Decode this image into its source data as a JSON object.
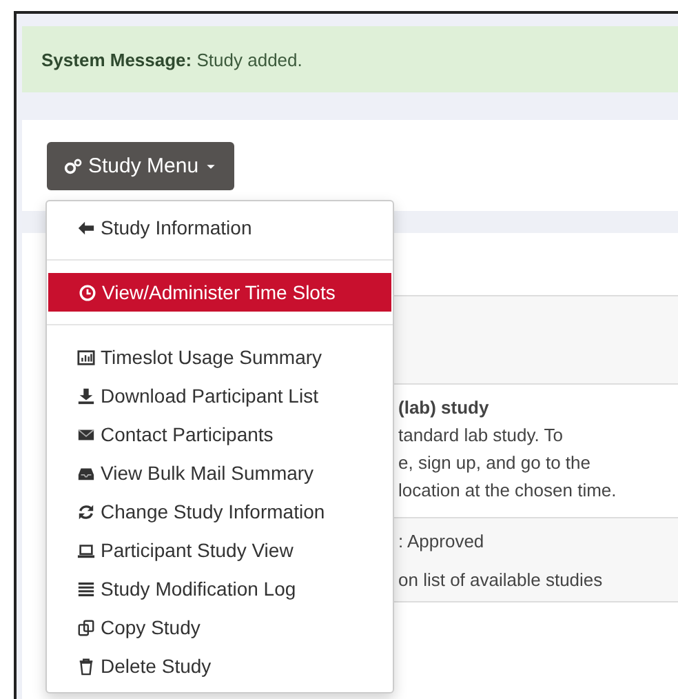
{
  "system_message": {
    "label": "System Message:",
    "text": "Study added."
  },
  "study_menu": {
    "label": "Study Menu",
    "expanded": true,
    "groups": [
      [
        {
          "label": "Study Information",
          "selected": false
        }
      ],
      [
        {
          "label": "View/Administer Time Slots",
          "selected": true
        }
      ],
      [
        {
          "label": "Timeslot Usage Summary",
          "selected": false
        },
        {
          "label": "Download Participant List",
          "selected": false
        },
        {
          "label": "Contact Participants",
          "selected": false
        },
        {
          "label": "View Bulk Mail Summary",
          "selected": false
        },
        {
          "label": "Change Study Information",
          "selected": false
        },
        {
          "label": "Participant Study View",
          "selected": false
        },
        {
          "label": "Study Modification Log",
          "selected": false
        },
        {
          "label": "Copy Study",
          "selected": false
        },
        {
          "label": "Delete Study",
          "selected": false
        }
      ]
    ]
  },
  "details": [
    {
      "lines": [
        "**(lab) study**",
        "tandard lab study. To",
        "e, sign up, and go to the",
        "location at the chosen time."
      ]
    },
    {
      "lines": [
        ": Approved",
        "on list of available studies"
      ]
    }
  ]
}
